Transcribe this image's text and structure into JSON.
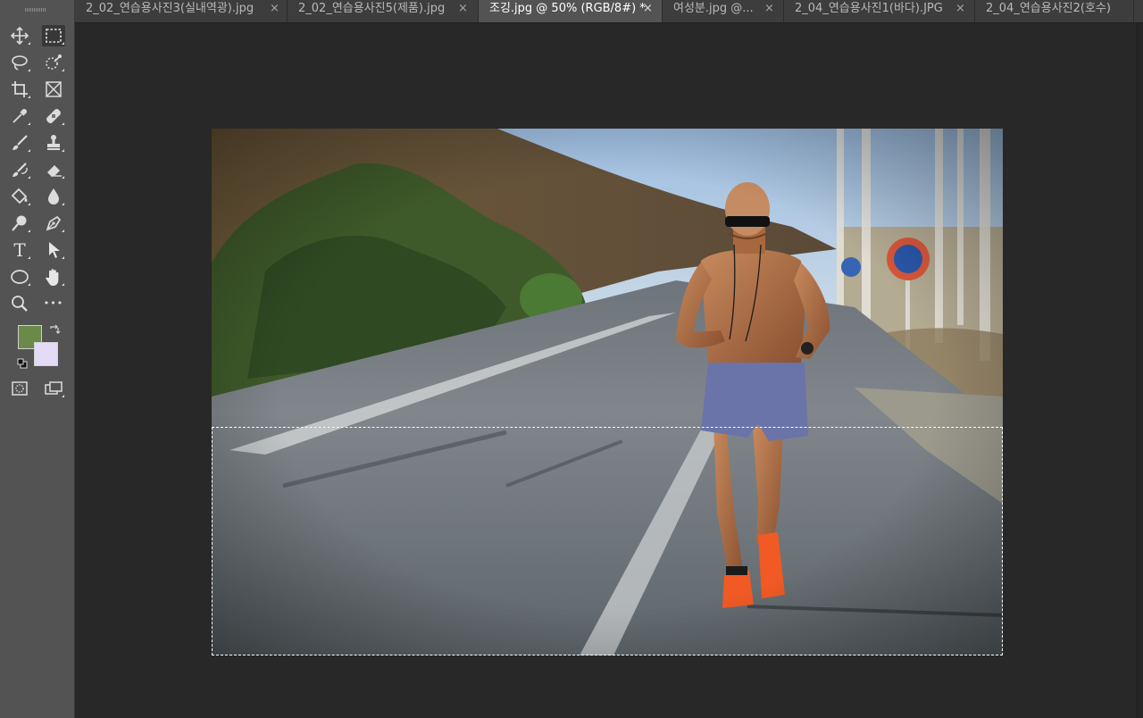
{
  "tabs": [
    {
      "label": "2_02_연습용사진3(실내역광).jpg",
      "close": "×",
      "active": false
    },
    {
      "label": "2_02_연습용사진5(제품).jpg",
      "close": "×",
      "active": false
    },
    {
      "label": "조깅.jpg @ 50% (RGB/8#) *",
      "close": "×",
      "active": true
    },
    {
      "label": "여성분.jpg @...",
      "close": "×",
      "active": false
    },
    {
      "label": "2_04_연습용사진1(바다).JPG",
      "close": "×",
      "active": false
    },
    {
      "label": "2_04_연습용사진2(호수)",
      "close": "",
      "active": false
    }
  ],
  "tools": [
    {
      "icon": "move-icon"
    },
    {
      "icon": "rectangular-marquee-icon",
      "active": true
    },
    {
      "icon": "lasso-icon"
    },
    {
      "icon": "quick-selection-icon"
    },
    {
      "icon": "crop-icon"
    },
    {
      "icon": "frame-icon"
    },
    {
      "icon": "eyedropper-icon"
    },
    {
      "icon": "healing-brush-icon"
    },
    {
      "icon": "brush-icon"
    },
    {
      "icon": "clone-stamp-icon"
    },
    {
      "icon": "history-brush-icon"
    },
    {
      "icon": "eraser-icon"
    },
    {
      "icon": "paint-bucket-icon"
    },
    {
      "icon": "blur-icon"
    },
    {
      "icon": "dodge-icon"
    },
    {
      "icon": "pen-icon"
    },
    {
      "icon": "type-icon",
      "glyph": "T"
    },
    {
      "icon": "path-selection-icon"
    },
    {
      "icon": "ellipse-icon"
    },
    {
      "icon": "hand-icon"
    },
    {
      "icon": "zoom-icon"
    },
    {
      "icon": "more-tools-icon",
      "glyph": "•••"
    },
    {
      "icon": "quick-mask-icon"
    },
    {
      "icon": "screen-mode-icon"
    }
  ],
  "colors": {
    "foreground": "#6b8a4a",
    "background": "#e4dcf7",
    "selection_marquee": "dashed black/white"
  },
  "document": {
    "subject": "runner-on-road-photo"
  }
}
